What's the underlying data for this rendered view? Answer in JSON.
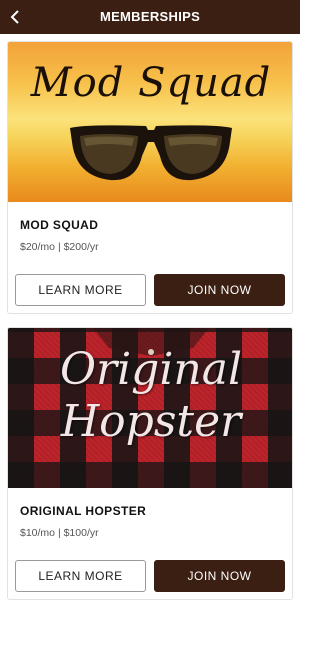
{
  "header": {
    "title": "MEMBERSHIPS",
    "back_icon": "chevron-left-icon"
  },
  "memberships": [
    {
      "image_text": "Mod Squad",
      "name": "MOD SQUAD",
      "price": "$20/mo | $200/yr",
      "learn_more_label": "LEARN MORE",
      "join_label": "JOIN NOW"
    },
    {
      "image_text_line1": "Original",
      "image_text_line2": "Hopster",
      "name": "ORIGINAL HOPSTER",
      "price": "$10/mo | $100/yr",
      "learn_more_label": "LEARN MORE",
      "join_label": "JOIN NOW"
    }
  ],
  "colors": {
    "brand_dark": "#3a1f12",
    "card_border": "#e2e2e2"
  }
}
